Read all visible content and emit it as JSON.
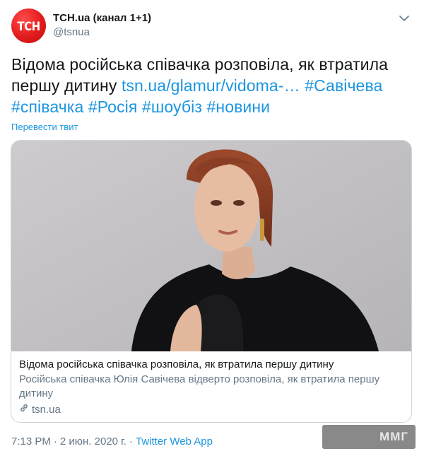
{
  "author": {
    "display_name": "ТСН.ua (канал 1+1)",
    "handle": "@tsnua",
    "avatar_text": "ТСН",
    "avatar_color": "#e21c1c"
  },
  "tweet": {
    "text": "Відома російська співачка розповіла, як втратила першу дитину",
    "link_text": "tsn.ua/glamur/vidoma-…",
    "hashtags": [
      "#Савічева",
      "#співачка",
      "#Росія",
      "#шоубіз",
      "#новини"
    ],
    "translate_label": "Перевести твит"
  },
  "card": {
    "title": "Відома російська співачка розповіла, як втратила першу дитину",
    "description": "Російська співачка Юлія Савічева відверто розповіла, як втратила першу дитину",
    "domain": "tsn.ua"
  },
  "meta": {
    "time": "7:13 PM",
    "separator": "·",
    "date": "2 июн. 2020 г.",
    "app": "Twitter Web App"
  },
  "watermark": {
    "text": "ММГ"
  },
  "colors": {
    "link": "#1b95e0",
    "secondary": "#657786",
    "border": "#ccd6dd"
  }
}
